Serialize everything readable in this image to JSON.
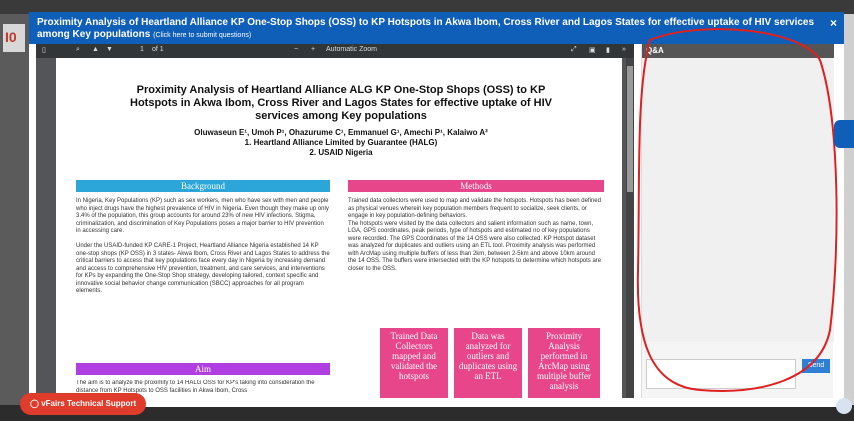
{
  "modal": {
    "title": "Proximity Analysis of Heartland Alliance KP One-Stop Shops (OSS) to KP Hotspots in Akwa Ibom, Cross River and Lagos States for effective uptake of HIV services among Key populations",
    "title_suffix": "(Click here to submit questions)",
    "close_label": "×"
  },
  "viewer": {
    "page_indicator": "1",
    "page_total": "of 1",
    "zoom_label": "Automatic Zoom"
  },
  "poster": {
    "title": "Proximity Analysis of Heartland Alliance ALG KP One-Stop Shops (OSS) to KP Hotspots in Akwa Ibom, Cross River and Lagos States for effective uptake of HIV services among Key populations",
    "authors": "Oluwaseun E¹, Umoh P¹, Ohazurume C¹, Emmanuel G¹, Amechi P¹, Kalaiwo A²",
    "affil1": "1. Heartland Alliance Limited by Guarantee (HALG)",
    "affil2": "2. USAID Nigeria",
    "background_header": "Background",
    "background_text": "In Nigeria, Key Populations (KP) such as sex workers, men who have sex with men and people who inject drugs have the highest prevalence of HIV in Nigeria. Even though they make up only 3.4% of the population, this group accounts for around 23% of new HIV infections. Stigma, criminalization, and discrimination of Key Populations poses a major barrier to HIV prevention in accessing care.\n\nUnder the USAID-funded KP CARE-1 Project, Heartland Alliance Nigeria established 14 KP one-stop shops (KP OSS) in 3 states- Akwa Ibom, Cross River and Lagos States to address the critical barriers to access that key populations face every day in Nigeria by increasing demand and access to comprehensive HIV prevention, treatment, and care services, and interventions for KPs by expanding the One-Stop Shop strategy, developing tailored, context specific and innovative social behavior change communication (SBCC) approaches for all program elements.",
    "methods_header": "Methods",
    "methods_text": "Trained data collectors were used to map and validate the hotspots. Hotspots has been defined as physical venues wherein key population members frequent to socialize, seek clients, or engage in key population-defining behaviors.\nThe hotspots were visited by the data collectors and salient information such as name, town, LGA, GPS coordinates, peak periods, type of hotspots and estimated no of key populations were recorded. The GPS Coordinates of the 14 OSS were also collected. KP Hotspot dataset was analyzed for duplicates and outliers using an ETL tool. Proximity analysis was performed with ArcMap using multiple buffers of less than 2km, between 2-5km and above 10km around the 14 OSS. The buffers were intersected with the KP hotspots to determine which hotspots are closer to the OSS.",
    "aim_header": "Aim",
    "aim_text": "The aim is to analyze the proximity to 14 HALG OSS for KP's taking into consideration the distance from KP Hotspots to OSS facilities in Akwa Ibom, Cross",
    "box1": "Trained Data Collectors mapped and validated the hotspots",
    "box2": "Data was analyzed for outliers and duplicates using an ETL",
    "box3": "Proximity Analysis performed in ArcMap using multiple buffer analysis"
  },
  "qa": {
    "title": "Q&A",
    "send_label": "Send"
  },
  "support": {
    "label": "vFairs Technical Support"
  },
  "colors": {
    "title_bar": "#0f5fb8",
    "background_header": "#2ca6d9",
    "methods_header": "#e8468a",
    "aim_header": "#b03ee0",
    "annotation_red": "#e02020"
  }
}
